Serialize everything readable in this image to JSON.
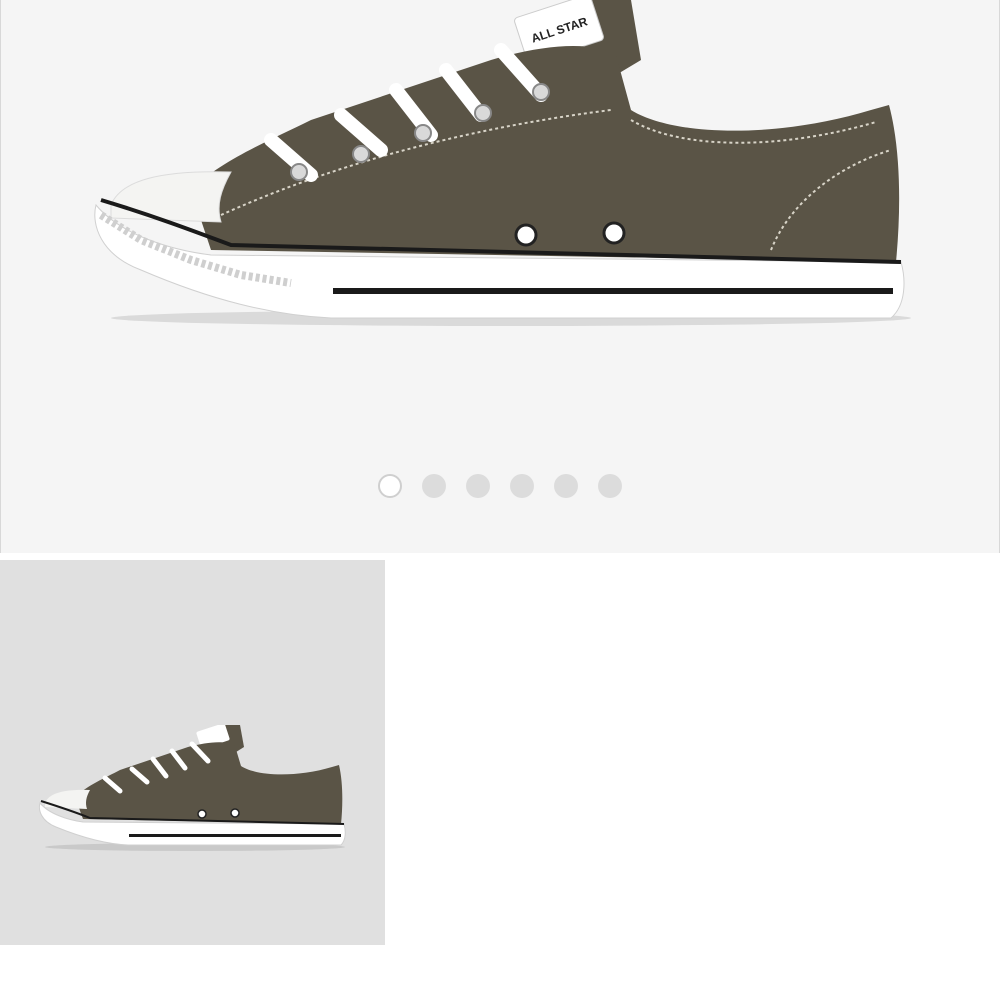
{
  "colors": {
    "gallery_background": "#f5f5f5",
    "thumbnail_background": "#e0e0e0",
    "dot_inactive": "#dcdcdc",
    "dot_active": "#ffffff",
    "shoe_canvas": "#5a5446",
    "shoe_sole": "#ffffff",
    "sole_stripe": "#1a1a1a"
  },
  "gallery": {
    "image_count": 6,
    "active_index": 0,
    "dots": [
      {
        "active": true
      },
      {
        "active": false
      },
      {
        "active": false
      },
      {
        "active": false
      },
      {
        "active": false
      },
      {
        "active": false
      }
    ]
  },
  "thumbnails": [
    {
      "selected": true
    }
  ],
  "brand": {
    "tongue_label_text": "ALL STAR"
  }
}
